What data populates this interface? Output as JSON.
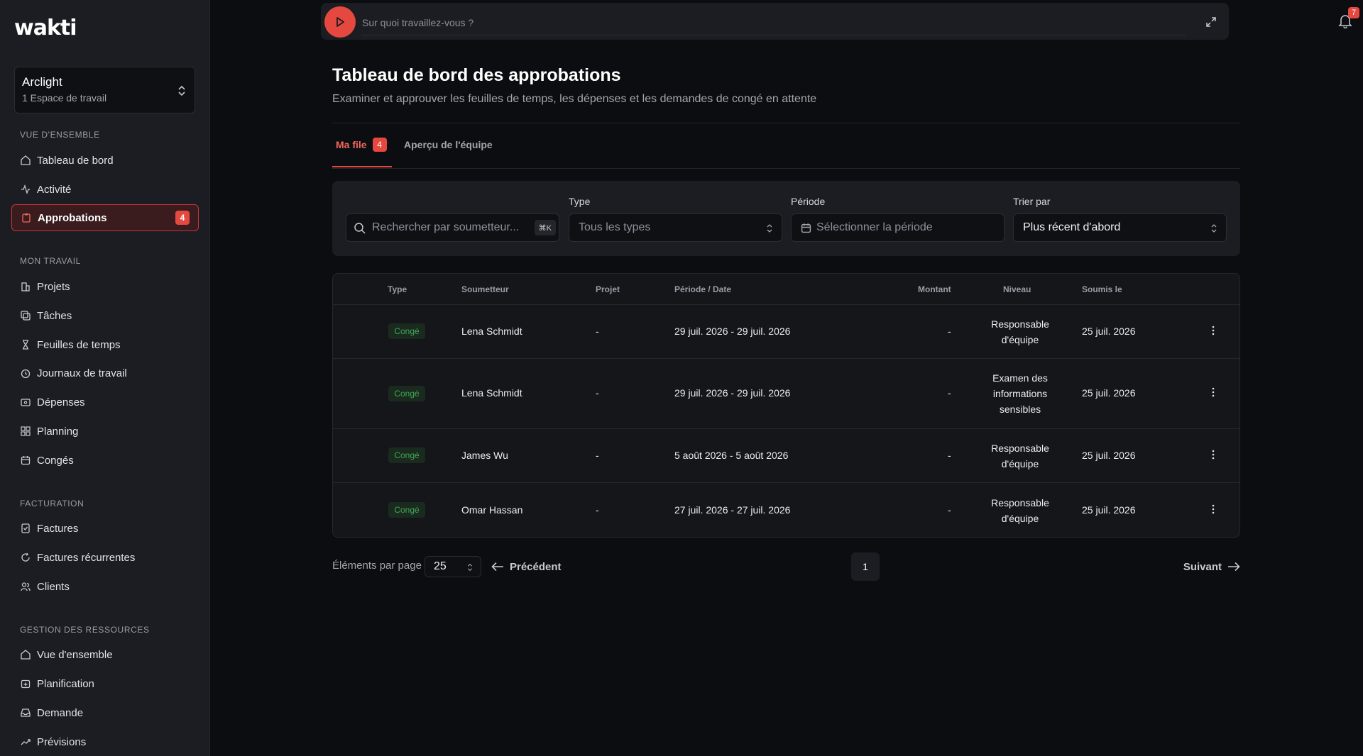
{
  "app": {
    "logo": "wakti"
  },
  "workspace": {
    "name": "Arclight",
    "subtitle": "1 Espace de travail"
  },
  "sidebar": {
    "sections": [
      {
        "title": "VUE D'ENSEMBLE",
        "items": [
          {
            "label": "Tableau de bord",
            "icon": "home-icon"
          },
          {
            "label": "Activité",
            "icon": "activity-icon"
          },
          {
            "label": "Approbations",
            "icon": "clipboard-icon",
            "badge": "4",
            "active": true
          }
        ]
      },
      {
        "title": "MON TRAVAIL",
        "items": [
          {
            "label": "Projets",
            "icon": "building-icon"
          },
          {
            "label": "Tâches",
            "icon": "tasks-icon"
          },
          {
            "label": "Feuilles de temps",
            "icon": "hourglass-icon"
          },
          {
            "label": "Journaux de travail",
            "icon": "clock-icon"
          },
          {
            "label": "Dépenses",
            "icon": "wallet-icon"
          },
          {
            "label": "Planning",
            "icon": "grid-icon"
          },
          {
            "label": "Congés",
            "icon": "calendar-icon"
          }
        ]
      },
      {
        "title": "FACTURATION",
        "items": [
          {
            "label": "Factures",
            "icon": "invoice-icon"
          },
          {
            "label": "Factures récurrentes",
            "icon": "refresh-icon"
          },
          {
            "label": "Clients",
            "icon": "users-icon"
          }
        ]
      },
      {
        "title": "GESTION DES RESSOURCES",
        "items": [
          {
            "label": "Vue d'ensemble",
            "icon": "home-icon"
          },
          {
            "label": "Planification",
            "icon": "calendar-plus-icon"
          },
          {
            "label": "Demande",
            "icon": "inbox-icon"
          },
          {
            "label": "Prévisions",
            "icon": "trend-icon"
          }
        ]
      }
    ]
  },
  "timer": {
    "placeholder": "Sur quoi travaillez-vous ?"
  },
  "notifications": {
    "count": "7"
  },
  "header": {
    "title": "Tableau de bord des approbations",
    "subtitle": "Examiner et approuver les feuilles de temps, les dépenses et les demandes de congé en attente"
  },
  "tabs": [
    {
      "label": "Ma file",
      "badge": "4",
      "active": true
    },
    {
      "label": "Aperçu de l'équipe"
    }
  ],
  "filters": {
    "search_placeholder": "Rechercher par soumetteur...",
    "search_shortcut": "⌘K",
    "type_label": "Type",
    "type_value": "Tous les types",
    "period_label": "Période",
    "period_placeholder": "Sélectionner la période",
    "sort_label": "Trier par",
    "sort_value": "Plus récent d'abord"
  },
  "table": {
    "headers": [
      "Type",
      "Soumetteur",
      "Projet",
      "Période / Date",
      "Montant",
      "Niveau",
      "Soumis le"
    ],
    "rows": [
      {
        "type": "Congé",
        "submitter": "Lena Schmidt",
        "project": "-",
        "period": "29 juil. 2026 - 29 juil. 2026",
        "amount": "-",
        "level_lines": [
          "Responsable",
          "d'équipe"
        ],
        "submitted": "25 juil. 2026"
      },
      {
        "type": "Congé",
        "submitter": "Lena Schmidt",
        "project": "-",
        "period": "29 juil. 2026 - 29 juil. 2026",
        "amount": "-",
        "level_lines": [
          "Examen des",
          "informations",
          "sensibles"
        ],
        "submitted": "25 juil. 2026"
      },
      {
        "type": "Congé",
        "submitter": "James Wu",
        "project": "-",
        "period": "5 août 2026 - 5 août 2026",
        "amount": "-",
        "level_lines": [
          "Responsable",
          "d'équipe"
        ],
        "submitted": "25 juil. 2026"
      },
      {
        "type": "Congé",
        "submitter": "Omar Hassan",
        "project": "-",
        "period": "27 juil. 2026 - 27 juil. 2026",
        "amount": "-",
        "level_lines": [
          "Responsable",
          "d'équipe"
        ],
        "submitted": "25 juil. 2026"
      }
    ]
  },
  "pagination": {
    "per_page_label": "Éléments par page",
    "per_page_value": "25",
    "prev_label": "Précédent",
    "current_page": "1",
    "next_label": "Suivant"
  },
  "colors": {
    "accent": "#e5483f",
    "badge_green": "#3fa657",
    "sidebar_bg": "#1b1d22",
    "page_bg": "#0c0d10"
  }
}
